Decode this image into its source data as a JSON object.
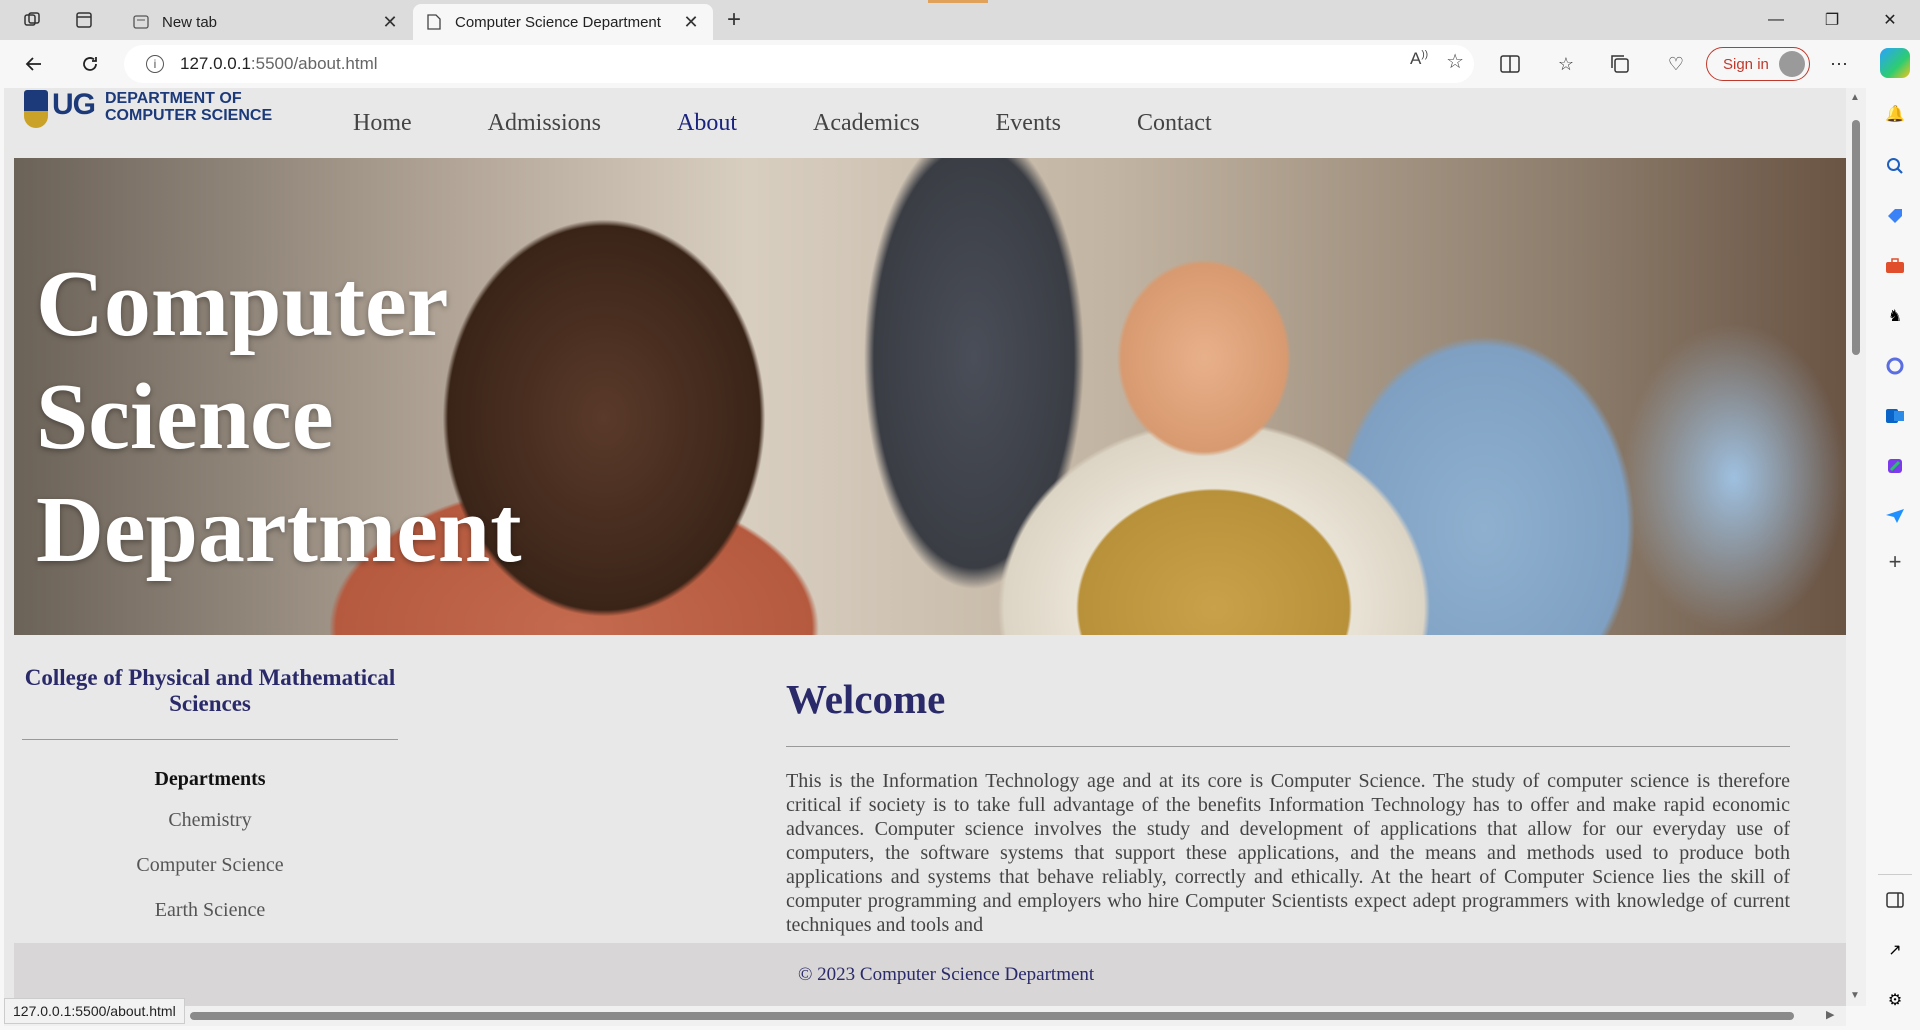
{
  "browser": {
    "tabs": [
      {
        "title": "New tab"
      },
      {
        "title": "Computer Science Department"
      }
    ],
    "address": {
      "host": "127.0.0.1",
      "path": ":5500/about.html"
    },
    "sign_in_label": "Sign in",
    "status_url": "127.0.0.1:5500/about.html"
  },
  "site": {
    "logo": {
      "mark": "UG",
      "line1": "DEPARTMENT OF",
      "line2": "COMPUTER SCIENCE"
    },
    "nav": [
      {
        "label": "Home"
      },
      {
        "label": "Admissions"
      },
      {
        "label": "About"
      },
      {
        "label": "Academics"
      },
      {
        "label": "Events"
      },
      {
        "label": "Contact"
      }
    ],
    "hero": {
      "line1": "Computer",
      "line2": "Science",
      "line3": "Department"
    },
    "sidebar": {
      "college": "College of Physical and Mathematical Sciences",
      "departments_heading": "Departments",
      "departments": [
        "Chemistry",
        "Computer Science",
        "Earth Science"
      ]
    },
    "main": {
      "heading": "Welcome",
      "body": "This is the Information Technology age and at its core is Computer Science. The study of computer science is therefore critical if society is to take full advantage of the benefits Information Technology has to offer and make rapid economic advances. Computer science involves the study and development of applications that allow for our everyday use of computers, the software systems that support these applications, and the means and methods used to produce both applications and systems that behave reliably, correctly and ethically. At the heart of Computer Science lies the skill of computer programming and employers who hire Computer Scientists expect adept programmers with knowledge of current techniques and tools and"
    },
    "footer": "© 2023 Computer Science Department"
  }
}
